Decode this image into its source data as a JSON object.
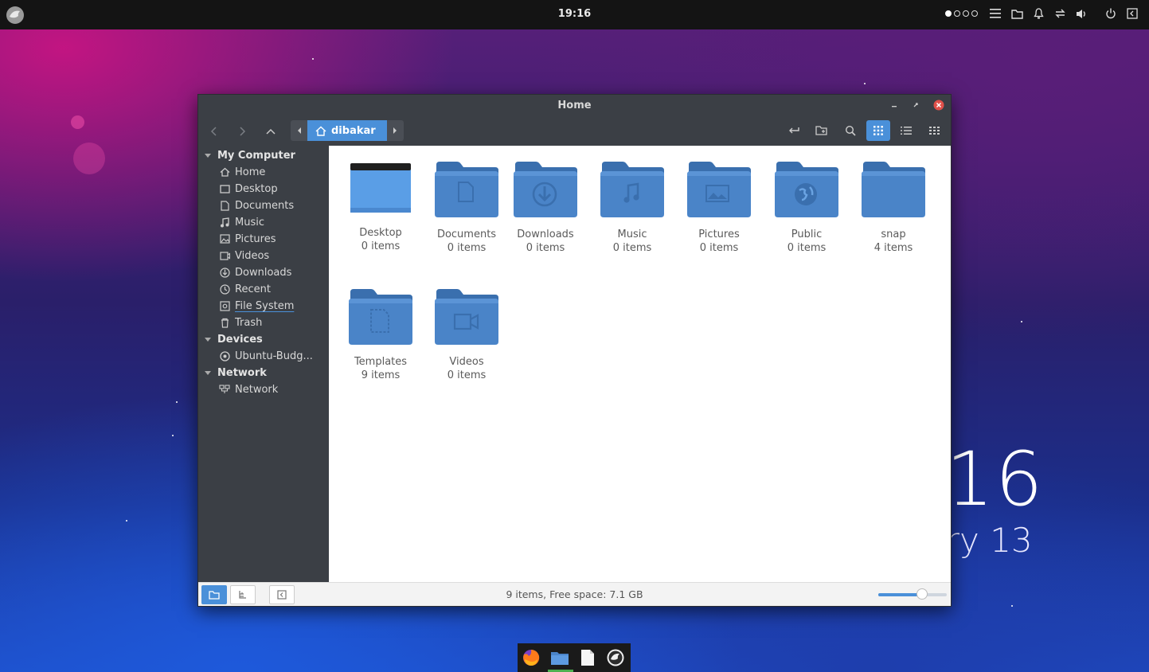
{
  "topbar": {
    "clock": "19:16",
    "workspaces": [
      true,
      false,
      false,
      false
    ]
  },
  "desktop": {
    "big_clock": "16",
    "big_date": "ary 13"
  },
  "window": {
    "title": "Home",
    "breadcrumb": {
      "current": "dibakar"
    },
    "sidebar": {
      "sections": [
        {
          "label": "My Computer",
          "items": [
            {
              "label": "Home",
              "icon": "home-icon"
            },
            {
              "label": "Desktop",
              "icon": "desktop-icon"
            },
            {
              "label": "Documents",
              "icon": "document-icon"
            },
            {
              "label": "Music",
              "icon": "music-icon"
            },
            {
              "label": "Pictures",
              "icon": "picture-icon"
            },
            {
              "label": "Videos",
              "icon": "video-icon"
            },
            {
              "label": "Downloads",
              "icon": "download-icon"
            },
            {
              "label": "Recent",
              "icon": "clock-icon"
            },
            {
              "label": "File System",
              "icon": "drive-icon"
            },
            {
              "label": "Trash",
              "icon": "trash-icon"
            }
          ]
        },
        {
          "label": "Devices",
          "items": [
            {
              "label": "Ubuntu-Budg...",
              "icon": "disc-icon"
            }
          ]
        },
        {
          "label": "Network",
          "items": [
            {
              "label": "Network",
              "icon": "network-icon"
            }
          ]
        }
      ]
    },
    "files": [
      {
        "name": "Desktop",
        "count": "0 items",
        "kind": "desktop"
      },
      {
        "name": "Documents",
        "count": "0 items",
        "kind": "documents"
      },
      {
        "name": "Downloads",
        "count": "0 items",
        "kind": "downloads"
      },
      {
        "name": "Music",
        "count": "0 items",
        "kind": "music"
      },
      {
        "name": "Pictures",
        "count": "0 items",
        "kind": "pictures"
      },
      {
        "name": "Public",
        "count": "0 items",
        "kind": "public"
      },
      {
        "name": "snap",
        "count": "4 items",
        "kind": "plain"
      },
      {
        "name": "Templates",
        "count": "9 items",
        "kind": "templates"
      },
      {
        "name": "Videos",
        "count": "0 items",
        "kind": "videos"
      }
    ],
    "status": "9 items, Free space: 7.1 GB",
    "zoom_level": 0.64
  },
  "colors": {
    "accent": "#4a90d9",
    "folder": "#4a84c8",
    "folder_dark": "#3a6fae",
    "sidebar_bg": "#3b3f45",
    "close": "#e0504a"
  },
  "dock": {
    "apps": [
      "firefox-icon",
      "files-icon",
      "text-editor-icon",
      "budgie-icon"
    ]
  }
}
